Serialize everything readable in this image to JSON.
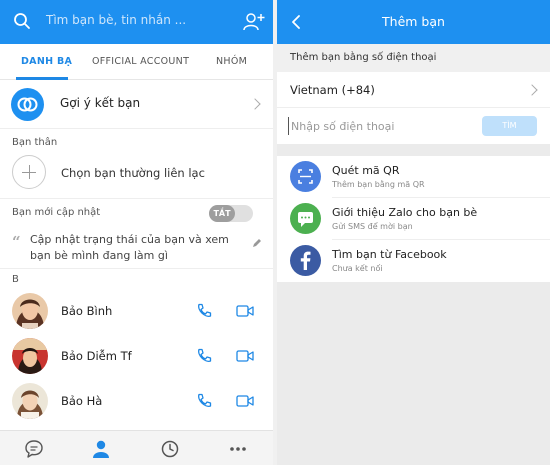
{
  "left": {
    "search_placeholder": "Tìm bạn bè, tin nhắn ...",
    "tabs": [
      {
        "label": "DANH BẠ",
        "active": true
      },
      {
        "label": "OFFICIAL ACCOUNT",
        "active": false
      },
      {
        "label": "NHÓM",
        "active": false
      }
    ],
    "suggest_label": "Gợi ý kết bạn",
    "close_friends_label": "Bạn thân",
    "choose_contacts_label": "Chọn bạn thường liên lạc",
    "updates_label": "Bạn mới cập nhật",
    "toggle_label": "TẮT",
    "status_prompt": "Cập nhật trạng thái của bạn và xem bạn bè mình đang làm gì",
    "section_letter": "B",
    "contacts": [
      {
        "name": "Bảo Bình"
      },
      {
        "name": "Bảo Diễm Tf"
      },
      {
        "name": "Bảo Hà"
      }
    ]
  },
  "right": {
    "title": "Thêm bạn",
    "section_label": "Thêm bạn bằng số điện thoại",
    "country": "Vietnam (+84)",
    "phone_placeholder": "Nhập số điện thoại",
    "search_button": "TÌM",
    "options": [
      {
        "title": "Quét mã QR",
        "subtitle": "Thêm bạn bằng mã QR",
        "icon": "qr-scan-icon",
        "color": "#4a7fe0"
      },
      {
        "title": "Giới thiệu Zalo cho bạn bè",
        "subtitle": "Gửi SMS để mời bạn",
        "icon": "sms-icon",
        "color": "#4cb050"
      },
      {
        "title": "Tìm bạn từ Facebook",
        "subtitle": "Chưa kết nối",
        "icon": "facebook-icon",
        "color": "#3b5ba3"
      }
    ]
  },
  "colors": {
    "brand_blue": "#1e90f0",
    "active_tab": "#1e88e5",
    "call_icon": "#1e88e5"
  }
}
